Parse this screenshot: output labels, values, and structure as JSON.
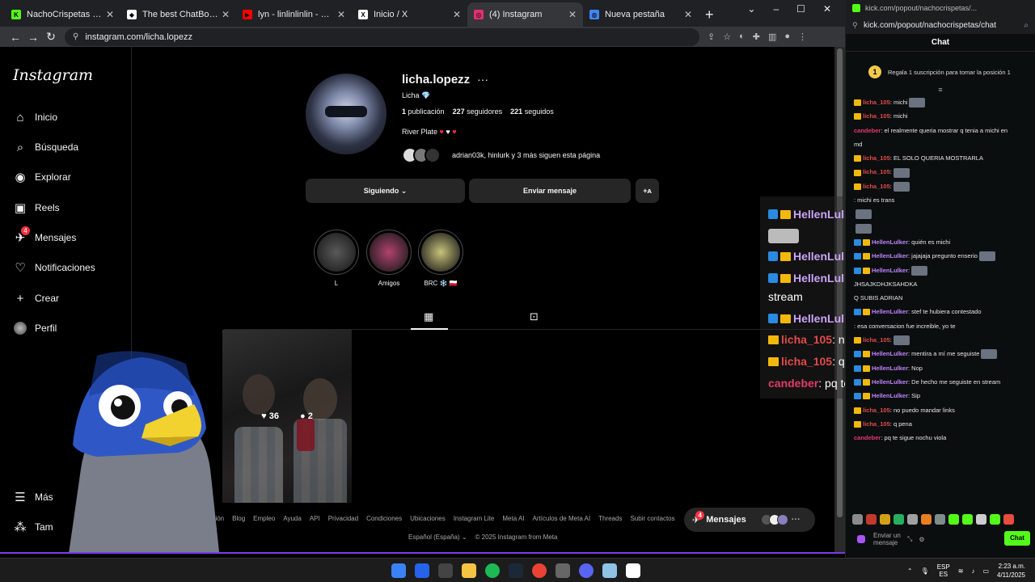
{
  "browser": {
    "tabs": [
      {
        "title": "NachoCrispetas Stream - Wi",
        "color": "#53fc18",
        "glyph": "K"
      },
      {
        "title": "The best ChatBot and Widge",
        "color": "#ffffff",
        "glyph": "◆"
      },
      {
        "title": "lyn - linlinlinlin - YouTube",
        "color": "#ff0000",
        "glyph": "▶"
      },
      {
        "title": "Inicio / X",
        "color": "#ffffff",
        "glyph": "X"
      },
      {
        "title": "(4) Instagram",
        "color": "#e1306c",
        "glyph": "◎"
      },
      {
        "title": "Nueva pestaña",
        "color": "#4285f4",
        "glyph": "◍"
      }
    ],
    "active_tab": 4,
    "url": "instagram.com/licha.lopezz"
  },
  "instagram": {
    "logo": "Instagram",
    "nav": [
      {
        "label": "Inicio",
        "icon": "home-icon",
        "glyph": "⌂"
      },
      {
        "label": "Búsqueda",
        "icon": "search-icon",
        "glyph": "⌕"
      },
      {
        "label": "Explorar",
        "icon": "compass-icon",
        "glyph": "◉"
      },
      {
        "label": "Reels",
        "icon": "reels-icon",
        "glyph": "▣"
      },
      {
        "label": "Mensajes",
        "icon": "messenger-icon",
        "glyph": "✈",
        "badge": "4"
      },
      {
        "label": "Notificaciones",
        "icon": "heart-icon",
        "glyph": "♡"
      },
      {
        "label": "Crear",
        "icon": "plus-icon",
        "glyph": "+"
      },
      {
        "label": "Perfil",
        "icon": "avatar",
        "glyph": ""
      }
    ],
    "more_label": "Más",
    "also_label": "Tam",
    "profile": {
      "username": "licha.lopezz",
      "display_name": "Licha 💎",
      "posts": "1",
      "posts_label": "publicación",
      "followers": "227",
      "followers_label": "seguidores",
      "following": "221",
      "following_label": "seguidos",
      "bio": "River Plate",
      "mutual_text": "adrian03k, hinlurk y 3 más siguen esta página",
      "follow_button": "Siguiendo",
      "message_button": "Enviar mensaje"
    },
    "highlights": [
      {
        "label": "L",
        "color": "#5a5a5a"
      },
      {
        "label": "Amigos",
        "color": "#b0426e"
      },
      {
        "label": "BRC ❄️ 🇵🇱",
        "color": "#c8c27a"
      }
    ],
    "post": {
      "likes": "36",
      "comments": "2"
    },
    "footer_links": [
      "ación",
      "Blog",
      "Empleo",
      "Ayuda",
      "API",
      "Privacidad",
      "Condiciones",
      "Ubicaciones",
      "Instagram Lite",
      "Meta AI",
      "Artículos de Meta AI",
      "Threads",
      "Subir contactos"
    ],
    "footer_lang": "Español (España) ⌄",
    "footer_copy": "© 2025 Instagram from Meta",
    "messages_pill": {
      "label": "Mensajes",
      "badge": "4"
    }
  },
  "kick": {
    "window_title": "kick.com/popout/nachocrispetas/...",
    "url": "kick.com/popout/nachocrispetas/chat",
    "header": "Chat",
    "pinned": {
      "number": "1",
      "text": "Regala 1 suscripción para tomar la posición 1"
    },
    "messages": [
      {
        "user": "licha_105",
        "text": ": michi",
        "color": "#e24a4a",
        "badges": "crown",
        "emote": true
      },
      {
        "user": "licha_105",
        "text": ": michi",
        "color": "#e24a4a",
        "badges": "crown",
        "emote": false
      },
      {
        "user": "candeber",
        "text": ": el realmente queria mostrar q tenia a michi en",
        "color": "#e23a6a",
        "badges": "",
        "emote": false
      },
      {
        "user": "",
        "text": "md",
        "color": "#ffffff",
        "badges": "",
        "emote": false
      },
      {
        "user": "licha_105",
        "text": ": EL SOLO QUERIA MOSTRARLA",
        "color": "#e24a4a",
        "badges": "crown",
        "emote": false
      },
      {
        "user": "licha_105",
        "text": ":",
        "color": "#e24a4a",
        "badges": "crown",
        "emote": true
      },
      {
        "user": "licha_105",
        "text": ":",
        "color": "#e24a4a",
        "badges": "crown",
        "emote": true
      },
      {
        "user": "",
        "text": ": michi es trans",
        "color": "#ffffff",
        "badges": "",
        "emote": false
      },
      {
        "user": "",
        "text": "",
        "color": "#ffffff",
        "badges": "",
        "emote": true
      },
      {
        "user": "",
        "text": "",
        "color": "#ffffff",
        "badges": "",
        "emote": true
      },
      {
        "user": "HellenLulker",
        "text": ": quién es michi",
        "color": "#c084fc",
        "badges": "both",
        "emote": false
      },
      {
        "user": "HellenLulker",
        "text": ": jajajaja pregunto enserio",
        "color": "#c084fc",
        "badges": "both",
        "emote": true
      },
      {
        "user": "",
        "text": "",
        "color": "#ffffff",
        "badges": "",
        "emote": false
      },
      {
        "user": "",
        "text": "",
        "color": "#ffffff",
        "badges": "",
        "emote": false
      },
      {
        "user": "HellenLulker",
        "text": ":",
        "color": "#c084fc",
        "badges": "both",
        "emote": true
      },
      {
        "user": "",
        "text": "JHSAJKDHJKSAHDKA",
        "color": "#ffffff",
        "badges": "",
        "emote": false
      },
      {
        "user": "",
        "text": "Q SUBIS ADRIAN",
        "color": "#ffffff",
        "badges": "",
        "emote": false
      },
      {
        "user": "HellenLulker",
        "text": ": stef te hubiera contestado",
        "color": "#c084fc",
        "badges": "both",
        "emote": false
      },
      {
        "user": "",
        "text": "",
        "color": "#ffffff",
        "badges": "",
        "emote": false
      },
      {
        "user": "",
        "text": ": esa conversacion fue increible, yo te",
        "color": "#ffffff",
        "badges": "",
        "emote": false
      },
      {
        "user": "",
        "text": "",
        "color": "#ffffff",
        "badges": "",
        "emote": false
      },
      {
        "user": "licha_105",
        "text": ":",
        "color": "#e24a4a",
        "badges": "crown",
        "emote": true
      },
      {
        "user": "HellenLulker",
        "text": ": mentira a mí me seguiste",
        "color": "#c084fc",
        "badges": "both",
        "emote": true
      },
      {
        "user": "HellenLulker",
        "text": ": Nop",
        "color": "#c084fc",
        "badges": "both",
        "emote": false
      },
      {
        "user": "HellenLulker",
        "text": ": De hecho me seguiste en stream",
        "color": "#c084fc",
        "badges": "both",
        "emote": false
      },
      {
        "user": "HellenLulker",
        "text": ": Sip",
        "color": "#c084fc",
        "badges": "both",
        "emote": false
      },
      {
        "user": "licha_105",
        "text": ": no puedo mandar links",
        "color": "#e24a4a",
        "badges": "crown",
        "emote": false
      },
      {
        "user": "licha_105",
        "text": ": q pena",
        "color": "#e24a4a",
        "badges": "crown",
        "emote": false
      },
      {
        "user": "candeber",
        "text": ": pq te sigue nochu viola",
        "color": "#e23a6a",
        "badges": "",
        "emote": false
      }
    ],
    "input_placeholder": "Enviar un mensaje",
    "chat_button": "Chat"
  },
  "overlay": {
    "lines": [
      {
        "user": "HellenLulker",
        "text": ": mentira a mí me seguiste",
        "color": "#c9a3f7",
        "badges": "both"
      },
      {
        "user": "HellenLulker",
        "text": ": Nop",
        "color": "#c9a3f7",
        "badges": "both"
      },
      {
        "user": "HellenLulker",
        "text": ": De hecho me seguiste en",
        "color": "#c9a3f7",
        "badges": "both"
      },
      {
        "user": "",
        "text": "stream",
        "color": "#ffffff",
        "badges": ""
      },
      {
        "user": "HellenLulker",
        "text": ": Sip",
        "color": "#c9a3f7",
        "badges": "both"
      },
      {
        "user": "licha_105",
        "text": ": no puedo mandar links",
        "color": "#e24a4a",
        "badges": "crown"
      },
      {
        "user": "licha_105",
        "text": ": q pena",
        "color": "#e24a4a",
        "badges": "crown"
      },
      {
        "user": "candeber",
        "text": ": pq te sigue nochu viola",
        "color": "#e23a6a",
        "badges": ""
      }
    ]
  },
  "taskbar": {
    "lang": "ESP",
    "lang_sub": "ES",
    "time": "2:23 a.m.",
    "date": "4/11/2025"
  }
}
